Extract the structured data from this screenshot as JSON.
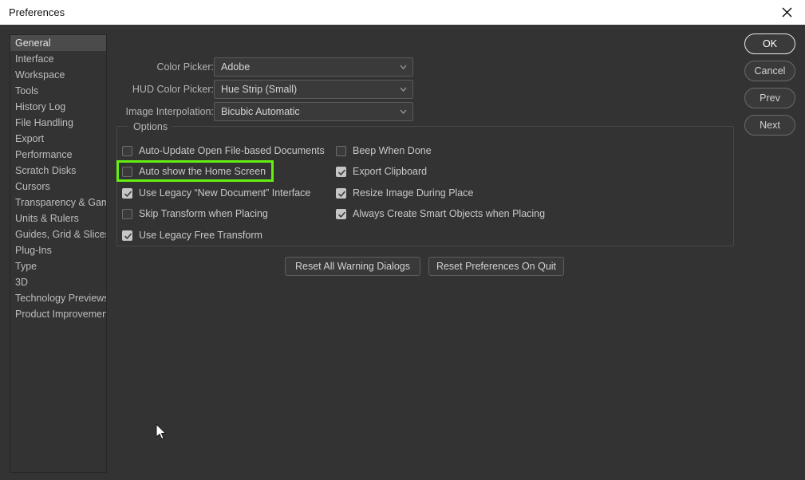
{
  "window": {
    "title": "Preferences",
    "close_icon": "close-icon"
  },
  "sidebar": {
    "items": [
      {
        "label": "General",
        "selected": true
      },
      {
        "label": "Interface",
        "selected": false
      },
      {
        "label": "Workspace",
        "selected": false
      },
      {
        "label": "Tools",
        "selected": false
      },
      {
        "label": "History Log",
        "selected": false
      },
      {
        "label": "File Handling",
        "selected": false
      },
      {
        "label": "Export",
        "selected": false
      },
      {
        "label": "Performance",
        "selected": false
      },
      {
        "label": "Scratch Disks",
        "selected": false
      },
      {
        "label": "Cursors",
        "selected": false
      },
      {
        "label": "Transparency & Gamut",
        "selected": false
      },
      {
        "label": "Units & Rulers",
        "selected": false
      },
      {
        "label": "Guides, Grid & Slices",
        "selected": false
      },
      {
        "label": "Plug-Ins",
        "selected": false
      },
      {
        "label": "Type",
        "selected": false
      },
      {
        "label": "3D",
        "selected": false
      },
      {
        "label": "Technology Previews",
        "selected": false
      },
      {
        "label": "Product Improvement",
        "selected": false
      }
    ]
  },
  "fields": [
    {
      "label": "Color Picker:",
      "value": "Adobe",
      "icon": "chevron-down-icon"
    },
    {
      "label": "HUD Color Picker:",
      "value": "Hue Strip (Small)",
      "icon": "chevron-down-icon"
    },
    {
      "label": "Image Interpolation:",
      "value": "Bicubic Automatic",
      "icon": "chevron-down-icon"
    }
  ],
  "options_group": {
    "title": "Options",
    "left_column": [
      {
        "label": "Auto-Update Open File-based Documents",
        "checked": false
      },
      {
        "label": "Auto show the Home Screen",
        "checked": false,
        "highlighted": true
      },
      {
        "label": "Use Legacy “New Document” Interface",
        "checked": true
      },
      {
        "label": "Skip Transform when Placing",
        "checked": false
      },
      {
        "label": "Use Legacy Free Transform",
        "checked": true
      }
    ],
    "right_column": [
      {
        "label": "Beep When Done",
        "checked": false
      },
      {
        "label": "Export Clipboard",
        "checked": true
      },
      {
        "label": "Resize Image During Place",
        "checked": true
      },
      {
        "label": "Always Create Smart Objects when Placing",
        "checked": true
      }
    ]
  },
  "reset_buttons": [
    {
      "label": "Reset All Warning Dialogs"
    },
    {
      "label": "Reset Preferences On Quit"
    }
  ],
  "action_buttons": [
    {
      "label": "OK",
      "default": true
    },
    {
      "label": "Cancel",
      "default": false
    },
    {
      "label": "Prev",
      "default": false
    },
    {
      "label": "Next",
      "default": false
    }
  ],
  "annotation": {
    "highlight_color": "#66ee11",
    "target": "Auto show the Home Screen"
  },
  "cursor": {
    "icon": "mouse-pointer-icon"
  }
}
